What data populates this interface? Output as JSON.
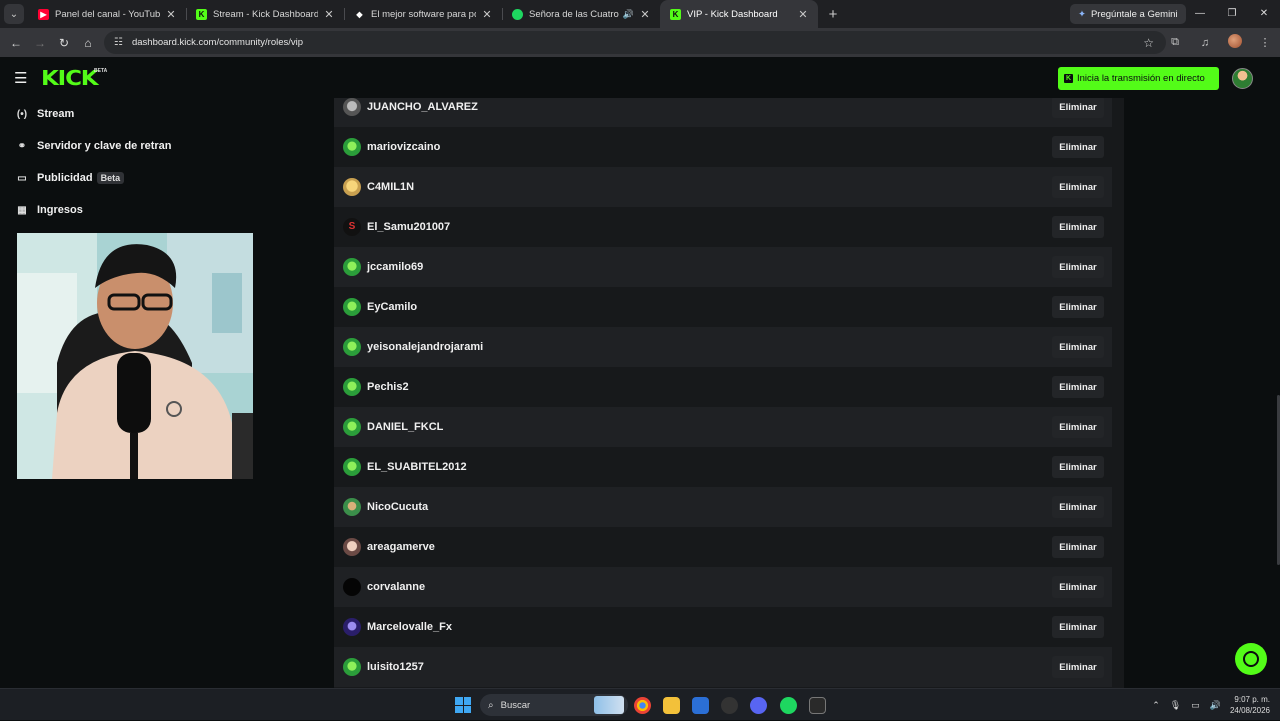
{
  "browser": {
    "tabs": [
      {
        "title": "Panel del canal - YouTube Studio",
        "favicon": "youtube-icon",
        "color": "#ff0033"
      },
      {
        "title": "Stream - Kick Dashboard",
        "favicon": "kick-icon",
        "color": "#53fc18"
      },
      {
        "title": "El mejor software para potenciar",
        "favicon": "diamond-icon",
        "color": "#ffffff"
      },
      {
        "title": "Señora de las Cuatro Décadas",
        "favicon": "spotify-icon",
        "color": "#1ed760"
      },
      {
        "title": "VIP - Kick Dashboard",
        "favicon": "kick-icon",
        "color": "#53fc18",
        "active": true
      }
    ],
    "gemini_label": "Pregúntale a Gemini",
    "url": "dashboard.kick.com/community/roles/vip"
  },
  "header": {
    "logo": "KICK",
    "logo_badge": "BETA",
    "go_live_label": "Inicia la transmisión en directo"
  },
  "sidebar": {
    "items": [
      {
        "label": "Stream",
        "icon": "broadcast-icon"
      },
      {
        "label": "Servidor y clave de retransmisión",
        "icon": "link-icon"
      },
      {
        "label": "Publicidad",
        "icon": "ad-window-icon",
        "badge": "Beta"
      },
      {
        "label": "Ingresos",
        "icon": "chart-icon"
      }
    ]
  },
  "vip_list": {
    "remove_label": "Eliminar",
    "users": [
      {
        "name": "JUANCHO_ALVAREZ",
        "avatar": "grey"
      },
      {
        "name": "mariovizcaino",
        "avatar": "green"
      },
      {
        "name": "C4MIL1N",
        "avatar": "tan"
      },
      {
        "name": "El_Samu201007",
        "avatar": "red"
      },
      {
        "name": "jccamilo69",
        "avatar": "green"
      },
      {
        "name": "EyCamilo",
        "avatar": "green"
      },
      {
        "name": "yeisonalejandrojarami",
        "avatar": "green"
      },
      {
        "name": "Pechis2",
        "avatar": "green"
      },
      {
        "name": "DANIEL_FKCL",
        "avatar": "green"
      },
      {
        "name": "EL_SUABITEL2012",
        "avatar": "green"
      },
      {
        "name": "NicoCucuta",
        "avatar": "nico"
      },
      {
        "name": "areagamerve",
        "avatar": "area"
      },
      {
        "name": "corvalanne",
        "avatar": "black"
      },
      {
        "name": "Marcelovalle_Fx",
        "avatar": "purple"
      },
      {
        "name": "luisito1257",
        "avatar": "green"
      }
    ]
  },
  "taskbar": {
    "search_placeholder": "Buscar",
    "time": "9:07 p. m.",
    "date": "24/08/2026"
  },
  "colors": {
    "brand": "#53fc18",
    "background": "#0b0e0f",
    "row": "#17191b",
    "row_alt": "#1f2124"
  }
}
